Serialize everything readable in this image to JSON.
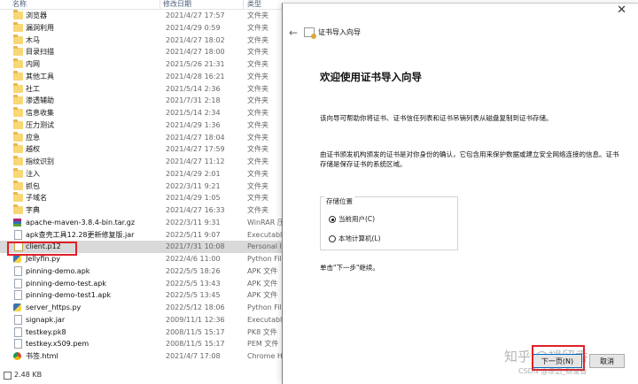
{
  "explorer": {
    "columns": {
      "name": "名称",
      "date": "修改日期",
      "type": "类型"
    },
    "files": [
      {
        "name": "浏览器",
        "date": "2021/4/27 17:57",
        "type": "文件夹",
        "icon": "folder-icon"
      },
      {
        "name": "漏洞利用",
        "date": "2021/4/29 0:59",
        "type": "文件夹",
        "icon": "folder-icon"
      },
      {
        "name": "木马",
        "date": "2021/4/27 18:02",
        "type": "文件夹",
        "icon": "folder-icon"
      },
      {
        "name": "目录扫描",
        "date": "2021/4/27 18:00",
        "type": "文件夹",
        "icon": "folder-icon"
      },
      {
        "name": "内网",
        "date": "2021/5/26 21:31",
        "type": "文件夹",
        "icon": "folder-icon"
      },
      {
        "name": "其他工具",
        "date": "2021/4/28 16:21",
        "type": "文件夹",
        "icon": "folder-icon"
      },
      {
        "name": "社工",
        "date": "2021/5/14 2:36",
        "type": "文件夹",
        "icon": "folder-icon"
      },
      {
        "name": "渗透辅助",
        "date": "2021/7/31 2:18",
        "type": "文件夹",
        "icon": "folder-icon"
      },
      {
        "name": "信息收集",
        "date": "2021/5/14 2:34",
        "type": "文件夹",
        "icon": "folder-icon"
      },
      {
        "name": "压力测试",
        "date": "2021/4/29 1:36",
        "type": "文件夹",
        "icon": "folder-icon"
      },
      {
        "name": "应急",
        "date": "2021/4/27 18:04",
        "type": "文件夹",
        "icon": "folder-icon"
      },
      {
        "name": "越权",
        "date": "2021/4/27 17:59",
        "type": "文件夹",
        "icon": "folder-icon"
      },
      {
        "name": "指纹识别",
        "date": "2021/4/27 11:12",
        "type": "文件夹",
        "icon": "folder-icon"
      },
      {
        "name": "注入",
        "date": "2021/4/29 2:01",
        "type": "文件夹",
        "icon": "folder-icon"
      },
      {
        "name": "抓包",
        "date": "2022/3/11 9:21",
        "type": "文件夹",
        "icon": "folder-icon"
      },
      {
        "name": "子域名",
        "date": "2021/4/29 1:05",
        "type": "文件夹",
        "icon": "folder-icon"
      },
      {
        "name": "字典",
        "date": "2021/4/27 16:33",
        "type": "文件夹",
        "icon": "folder-icon"
      },
      {
        "name": "apache-maven-3.8.4-bin.tar.gz",
        "date": "2022/3/11 9:31",
        "type": "WinRAR 压",
        "icon": "rar-icon"
      },
      {
        "name": "apk查壳工具12.28更新修复版.jar",
        "date": "2022/5/11 9:07",
        "type": "Executable",
        "icon": "jar-icon"
      },
      {
        "name": "client.p12",
        "date": "2021/7/31 10:08",
        "type": "Personal In",
        "icon": "certificate-icon"
      },
      {
        "name": "Jellyfin.py",
        "date": "2022/4/6 11:00",
        "type": "Python File",
        "icon": "python-icon"
      },
      {
        "name": "pinning-demo.apk",
        "date": "2022/5/5 18:26",
        "type": "APK 文件",
        "icon": "file-icon"
      },
      {
        "name": "pinning-demo-test.apk",
        "date": "2022/5/5 13:43",
        "type": "APK 文件",
        "icon": "file-icon"
      },
      {
        "name": "pinning-demo-test1.apk",
        "date": "2022/5/5 13:45",
        "type": "APK 文件",
        "icon": "file-icon"
      },
      {
        "name": "server_https.py",
        "date": "2022/5/12 18:06",
        "type": "Python File",
        "icon": "python-icon"
      },
      {
        "name": "signapk.jar",
        "date": "2009/11/1 12:36",
        "type": "Executable",
        "icon": "jar-icon"
      },
      {
        "name": "testkey.pk8",
        "date": "2008/11/5 15:17",
        "type": "PK8 文件",
        "icon": "file-icon"
      },
      {
        "name": "testkey.x509.pem",
        "date": "2008/11/5 15:17",
        "type": "PEM 文件",
        "icon": "file-icon"
      },
      {
        "name": "书签.html",
        "date": "2021/4/7 17:08",
        "type": "Chrome HT",
        "icon": "chrome-icon"
      }
    ],
    "selected_index": 19,
    "status": "2.48 KB"
  },
  "dialog": {
    "close": "✕",
    "wizard_title": "证书导入向导",
    "heading": "欢迎使用证书导入向导",
    "intro": "该向导可帮助你将证书、证书信任列表和证书吊销列表从磁盘复制到证书存储。",
    "description": "由证书颁发机构颁发的证书是对你身份的确认，它包含用来保护数据或建立安全网络连接的信息。证书存储是保存证书的系统区域。",
    "store_location_label": "存储位置",
    "options": [
      {
        "label": "当前用户(C)",
        "checked": true
      },
      {
        "label": "本地计算机(L)",
        "checked": false
      }
    ],
    "continue_hint": "单击\"下一步\"继续。",
    "next_button": "下一页(N)",
    "cancel_button": "取消"
  },
  "watermark": {
    "line1": "知乎 @褪留香",
    "line2": "CSDN @渗透_褪留香"
  },
  "colors": {
    "highlight_red": "#e0202a",
    "folder_yellow": "#f8d775",
    "selection_gray": "#d9d9d9"
  }
}
